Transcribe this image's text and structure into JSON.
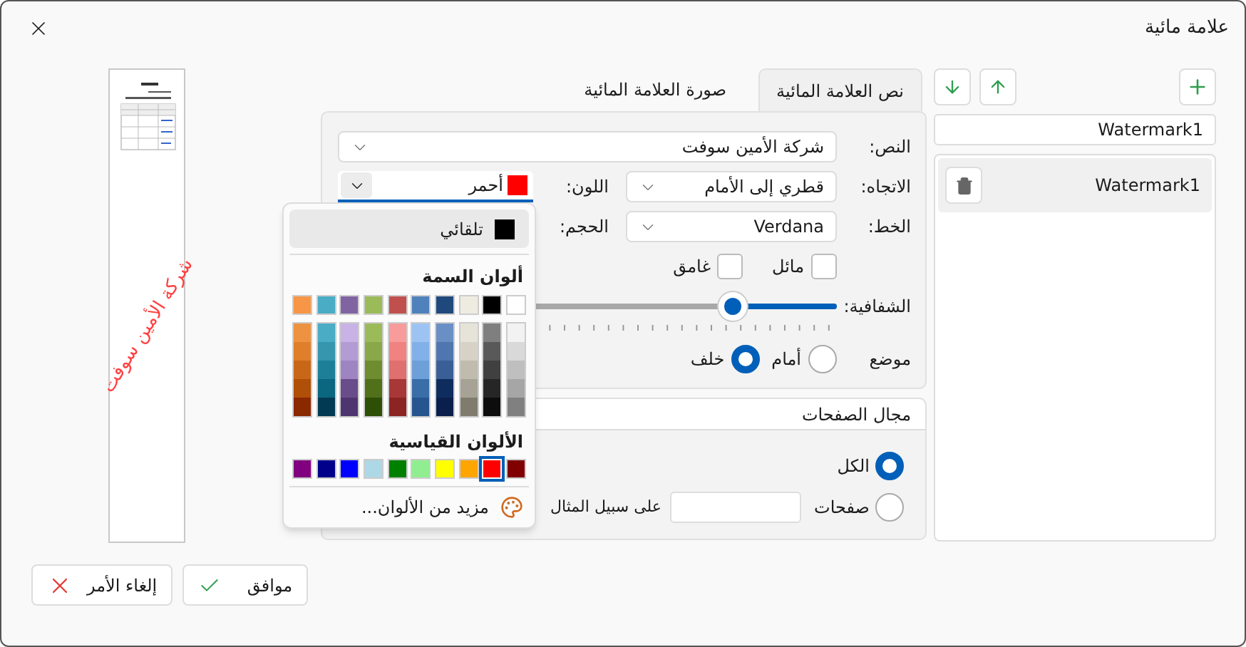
{
  "window": {
    "title": "علامة مائية"
  },
  "preview": {
    "watermark_text": "شركة الأمين سوفت"
  },
  "tabs": [
    {
      "label": "نص العلامة المائية",
      "selected": true
    },
    {
      "label": "صورة العلامة المائية",
      "selected": false
    }
  ],
  "text_tab": {
    "text": {
      "label": "النص:",
      "value": "شركة الأمين سوفت"
    },
    "direction": {
      "label": "الاتجاه:",
      "value": "قطري إلى الأمام"
    },
    "color": {
      "label": "اللون:",
      "value": "أحمر",
      "color": "#ff0000"
    },
    "font": {
      "label": "الخط:",
      "value": "Verdana"
    },
    "size": {
      "label": "الحجم:"
    },
    "italic": {
      "label": "مائل",
      "checked": false
    },
    "bold": {
      "label": "غامق",
      "checked": false
    },
    "transparency": {
      "label": "الشفافية:",
      "level": 0.21
    },
    "position": {
      "label": "موضع",
      "options": [
        {
          "label": "أمام",
          "selected": false
        },
        {
          "label": "خلف",
          "selected": true
        }
      ]
    }
  },
  "page_range": {
    "title": "مجال الصفحات",
    "options": [
      {
        "label": "الكل",
        "selected": true
      },
      {
        "label": "صفحات",
        "selected": false
      }
    ],
    "pages_hint": "على سبيل المثال"
  },
  "color_popup": {
    "automatic": {
      "label": "تلقائي",
      "color": "#000000"
    },
    "theme_title": "ألوان السمة",
    "theme": [
      {
        "color": "#ffffff",
        "shades": [
          {
            "color": "#f2f2f2"
          },
          {
            "color": "#d9d9d9"
          },
          {
            "color": "#bfbfbf"
          },
          {
            "color": "#a6a6a6"
          },
          {
            "color": "#808080"
          }
        ]
      },
      {
        "color": "#000000",
        "shades": [
          {
            "color": "#7f7f7f"
          },
          {
            "color": "#595959"
          },
          {
            "color": "#404040"
          },
          {
            "color": "#262626"
          },
          {
            "color": "#0d0d0d"
          }
        ]
      },
      {
        "color": "#eeece1",
        "shades": [
          {
            "color": "#e6e4d9"
          },
          {
            "color": "#d6d3c6"
          },
          {
            "color": "#bfbcae"
          },
          {
            "color": "#a6a396"
          },
          {
            "color": "#7f7c6e"
          }
        ]
      },
      {
        "color": "#1f497d",
        "shades": [
          {
            "color": "#6a8fc4"
          },
          {
            "color": "#4f76ae"
          },
          {
            "color": "#3a5f97"
          },
          {
            "color": "#0e2d5e"
          },
          {
            "color": "#0b1f4d"
          }
        ]
      },
      {
        "color": "#4f81bd",
        "shades": [
          {
            "color": "#9dc3f3"
          },
          {
            "color": "#82b0e9"
          },
          {
            "color": "#6d9fd9"
          },
          {
            "color": "#3a6ea8"
          },
          {
            "color": "#265590"
          }
        ]
      },
      {
        "color": "#c0504d",
        "shades": [
          {
            "color": "#f79b9b"
          },
          {
            "color": "#f08282"
          },
          {
            "color": "#e06f6f"
          },
          {
            "color": "#a83737"
          },
          {
            "color": "#8c2424"
          }
        ]
      },
      {
        "color": "#9bbb59",
        "shades": [
          {
            "color": "#9bbb59"
          },
          {
            "color": "#88a84a"
          },
          {
            "color": "#6e8c30"
          },
          {
            "color": "#507019"
          },
          {
            "color": "#2d4f06"
          }
        ]
      },
      {
        "color": "#8064a2",
        "shades": [
          {
            "color": "#c9b2e6"
          },
          {
            "color": "#b39bd4"
          },
          {
            "color": "#9e85c2"
          },
          {
            "color": "#684d8a"
          },
          {
            "color": "#4e3570"
          }
        ]
      },
      {
        "color": "#4bacc6",
        "shades": [
          {
            "color": "#4bacc6"
          },
          {
            "color": "#3596ae"
          },
          {
            "color": "#1e7f99"
          },
          {
            "color": "#0b6680"
          },
          {
            "color": "#013a52"
          }
        ]
      },
      {
        "color": "#f79646",
        "shades": [
          {
            "color": "#ed9240"
          },
          {
            "color": "#e07f2b"
          },
          {
            "color": "#c96719"
          },
          {
            "color": "#b04f07"
          },
          {
            "color": "#8a2800"
          }
        ]
      }
    ],
    "standard_title": "الألوان القياسية",
    "standard": [
      {
        "color": "#800000",
        "selected": false
      },
      {
        "color": "#ff0000",
        "selected": true
      },
      {
        "color": "#ffa500",
        "selected": false
      },
      {
        "color": "#ffff00",
        "selected": false
      },
      {
        "color": "#90ee90",
        "selected": false
      },
      {
        "color": "#008000",
        "selected": false
      },
      {
        "color": "#add8e6",
        "selected": false
      },
      {
        "color": "#0000ff",
        "selected": false
      },
      {
        "color": "#00008b",
        "selected": false
      },
      {
        "color": "#800080",
        "selected": false
      }
    ],
    "more": "مزيد من الألوان..."
  },
  "list": {
    "name_field": "Watermark1",
    "items": [
      {
        "label": "Watermark1",
        "selected": true
      }
    ]
  },
  "buttons": [
    {
      "label": "موافق",
      "kind": "ok"
    },
    {
      "label": "إلغاء الأمر",
      "kind": "cancel"
    }
  ]
}
